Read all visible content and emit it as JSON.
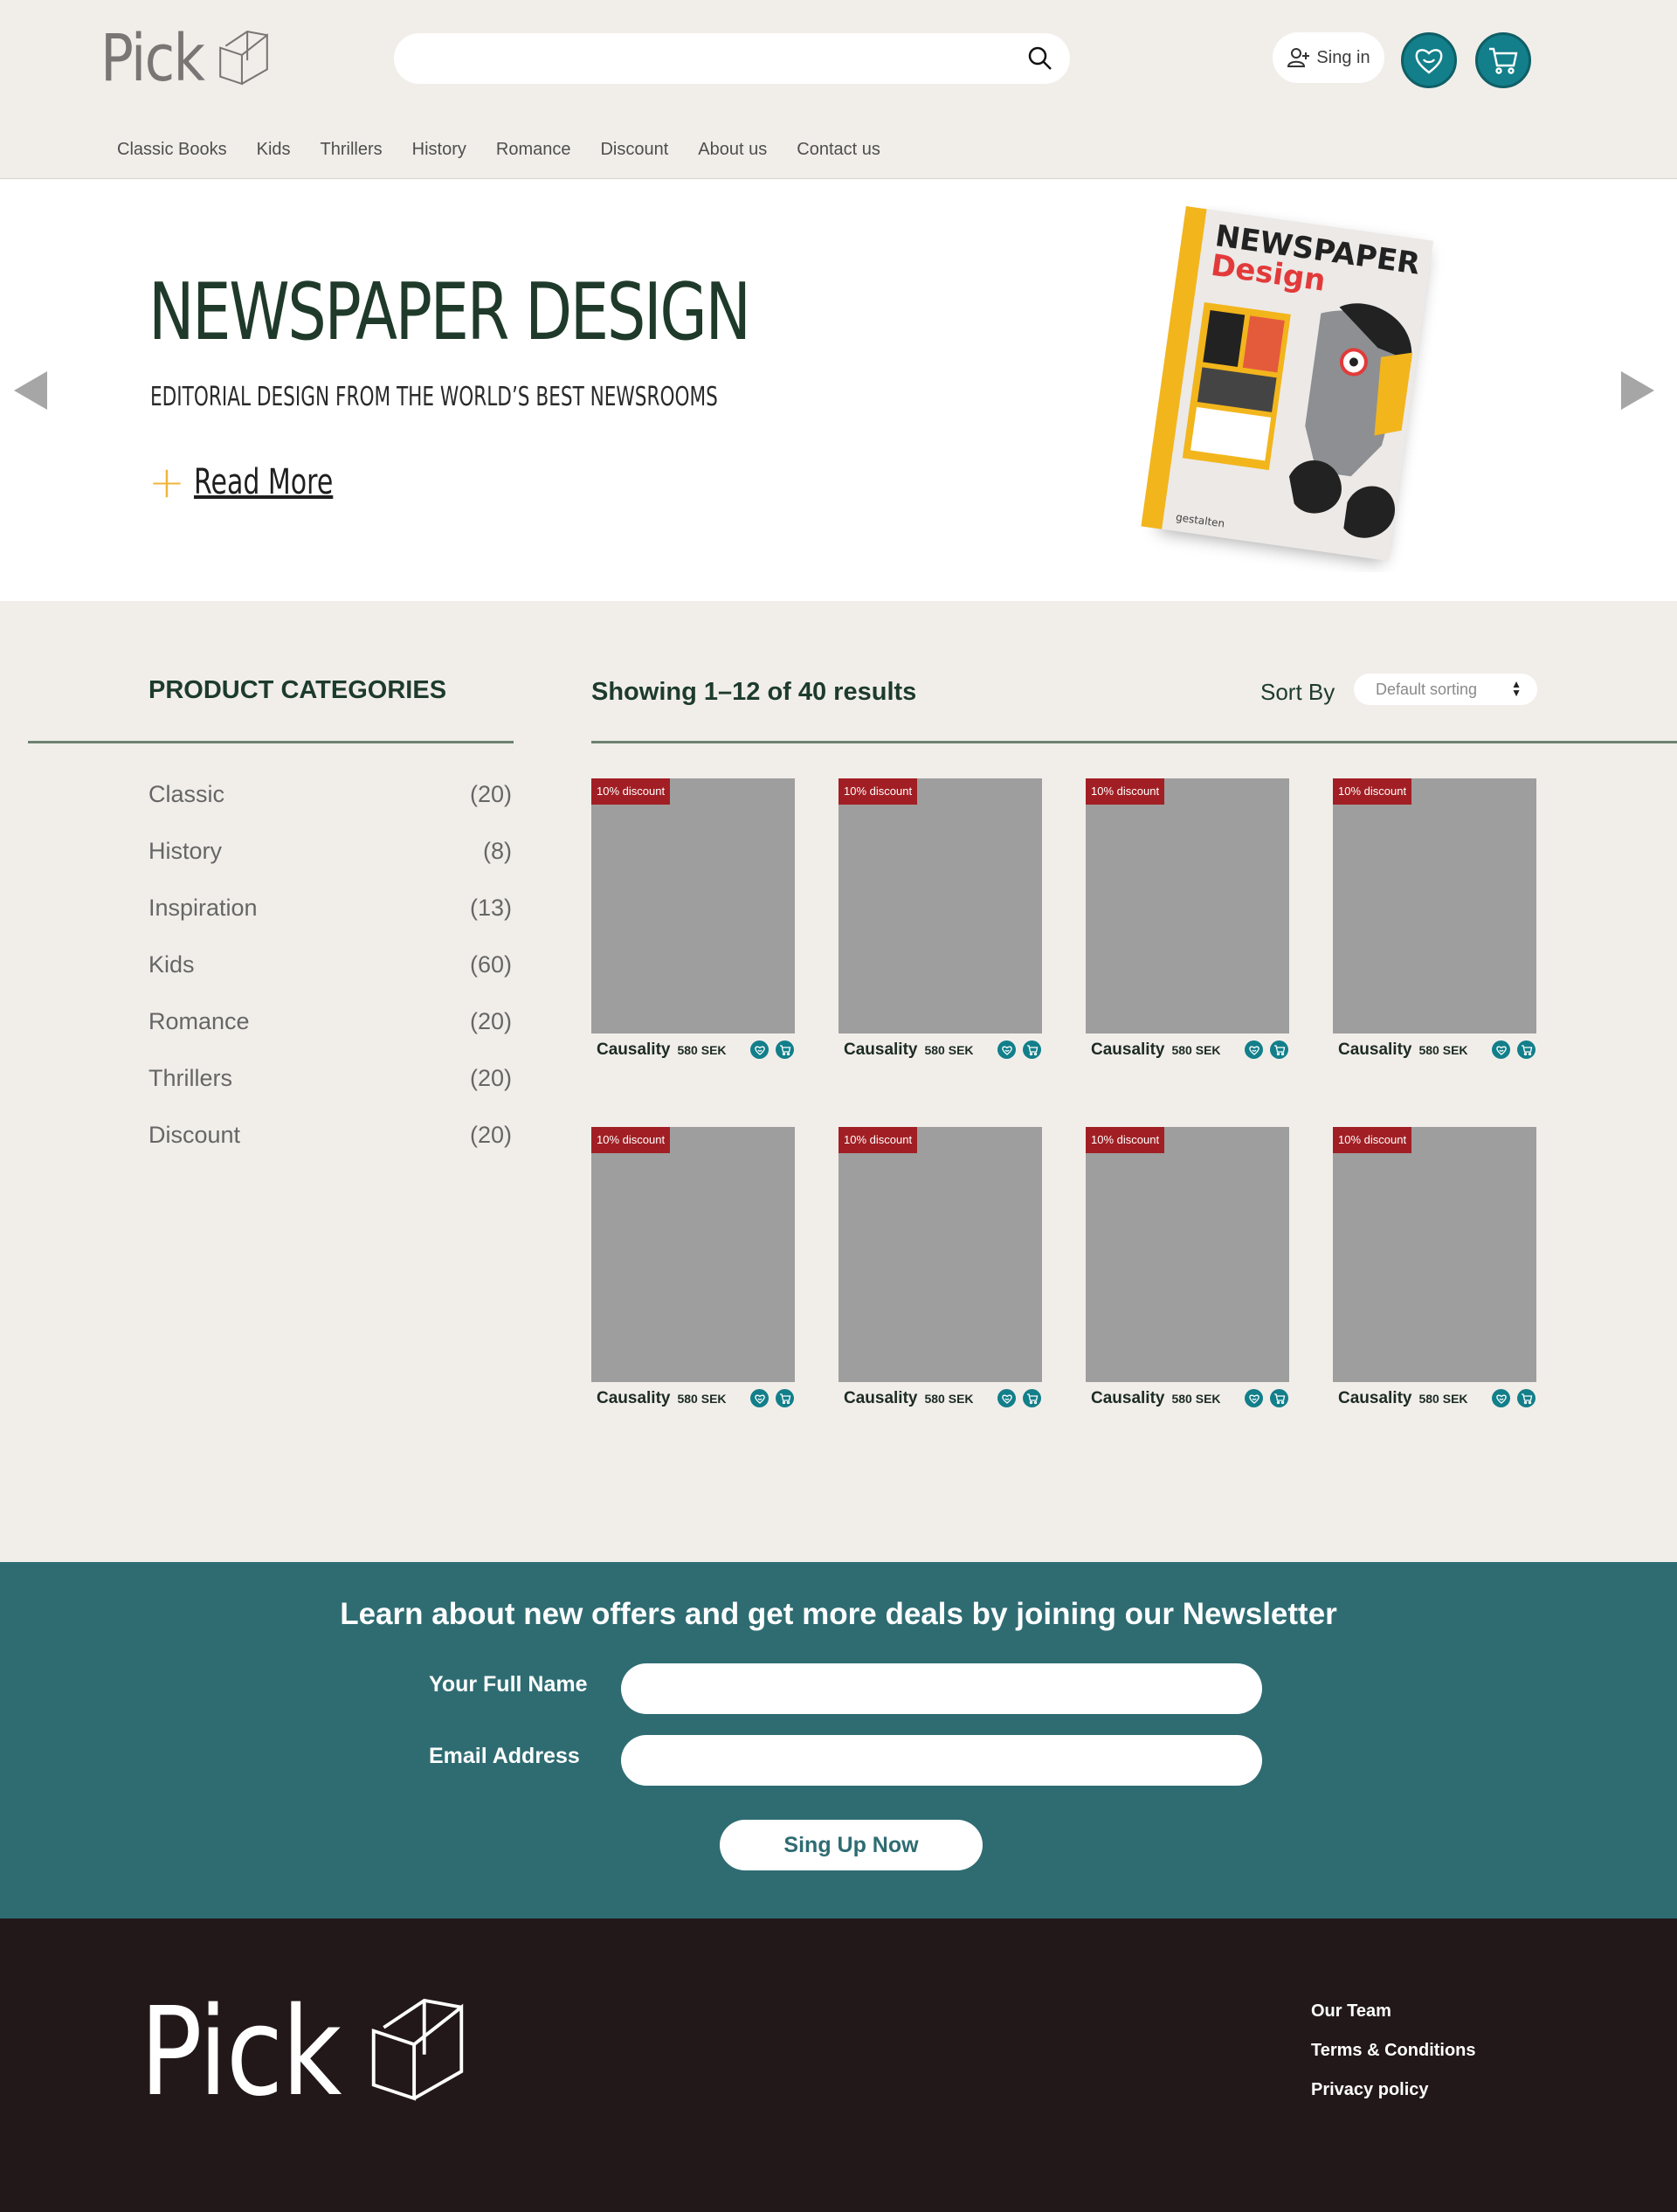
{
  "brand": {
    "logo_text": "Pick"
  },
  "header": {
    "search_placeholder": "",
    "signin_label": "Sing in",
    "nav": [
      "Classic Books",
      "Kids",
      "Thrillers",
      "History",
      "Romance",
      "Discount",
      "About us",
      "Contact us"
    ]
  },
  "hero": {
    "title": "NEWSPAPER DESIGN",
    "subtitle": "EDITORIAL DESIGN FROM THE WORLD’S BEST NEWSROOMS",
    "read_more": "Read More",
    "book": {
      "title_top": "NEWSPAPER",
      "title_bottom": "Design",
      "tagline": "Editorial Design from the World's Best Newsrooms",
      "publisher": "gestalten"
    }
  },
  "sidebar": {
    "title": "PRODUCT CATEGORIES",
    "categories": [
      {
        "name": "Classic",
        "count": "(20)"
      },
      {
        "name": "History",
        "count": "(8)"
      },
      {
        "name": "Inspiration",
        "count": "(13)"
      },
      {
        "name": "Kids",
        "count": "(60)"
      },
      {
        "name": "Romance",
        "count": "(20)"
      },
      {
        "name": "Thrillers",
        "count": "(20)"
      },
      {
        "name": "Discount",
        "count": "(20)"
      }
    ]
  },
  "results": {
    "showing": "Showing 1–12 of 40 results",
    "sort_label": "Sort By",
    "sort_value": "Default sorting"
  },
  "products": [
    {
      "badge": "10% discount",
      "title": "Causality",
      "price": "580 SEK"
    },
    {
      "badge": "10% discount",
      "title": "Causality",
      "price": "580 SEK"
    },
    {
      "badge": "10% discount",
      "title": "Causality",
      "price": "580 SEK"
    },
    {
      "badge": "10% discount",
      "title": "Causality",
      "price": "580 SEK"
    },
    {
      "badge": "10% discount",
      "title": "Causality",
      "price": "580 SEK"
    },
    {
      "badge": "10% discount",
      "title": "Causality",
      "price": "580 SEK"
    },
    {
      "badge": "10% discount",
      "title": "Causality",
      "price": "580 SEK"
    },
    {
      "badge": "10% discount",
      "title": "Causality",
      "price": "580 SEK"
    }
  ],
  "newsletter": {
    "title": "Learn about new offers and get more deals by joining our Newsletter",
    "name_label": "Your Full Name",
    "email_label": "Email Address",
    "button": "Sing Up Now"
  },
  "footer": {
    "links": [
      "Our Team",
      "Terms & Conditions",
      "Privacy policy"
    ]
  },
  "colors": {
    "teal": "#127f8a",
    "newsletter_bg": "#2e6c72",
    "footer_bg": "#22181a",
    "badge_red": "#a11f24",
    "page_bg": "#f1eeea",
    "heading_green": "#1d3b2c"
  },
  "icons": {
    "search": "search-icon",
    "signin": "user-plus-icon",
    "wishlist": "heart-smile-icon",
    "cart": "cart-icon",
    "prev": "arrow-left-icon",
    "next": "arrow-right-icon"
  }
}
